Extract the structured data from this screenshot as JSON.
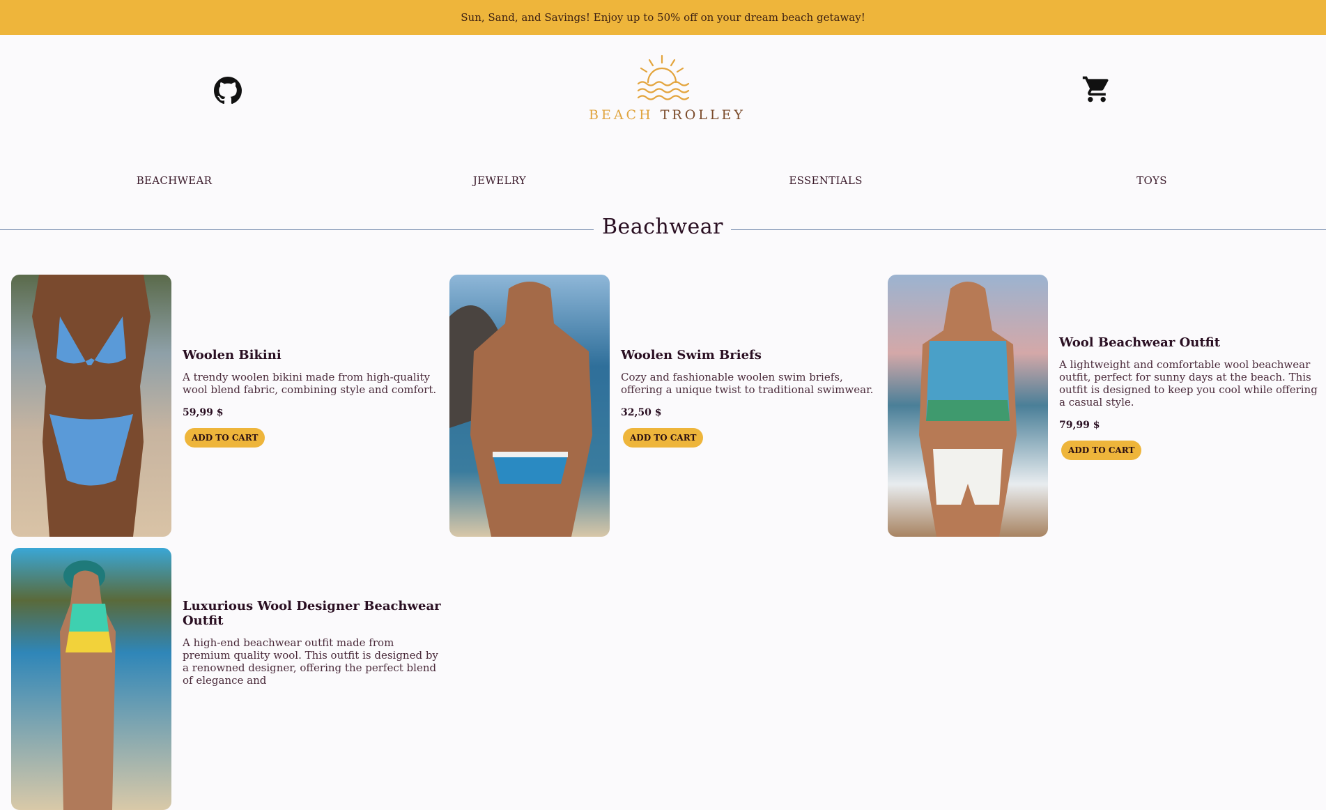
{
  "promo": {
    "text": "Sun, Sand, and Savings! Enjoy up to 50% off on your dream beach getaway!"
  },
  "header": {
    "logo_text_part1": "BEACH",
    "logo_text_part2": "TROLLEY",
    "github_icon": "github-icon",
    "cart_icon": "cart-icon"
  },
  "nav": {
    "items": [
      "BEACHWEAR",
      "JEWELRY",
      "ESSENTIALS",
      "TOYS"
    ]
  },
  "section": {
    "title": "Beachwear"
  },
  "colors": {
    "accent": "#eeb53b",
    "background": "#fbfafc",
    "text": "#2a0f22",
    "rule": "#7d93b3"
  },
  "products": [
    {
      "name": "Woolen Bikini",
      "description": "A trendy woolen bikini made from high-quality wool blend fabric, combining style and comfort.",
      "price": "59,99 $",
      "button": "ADD TO CART"
    },
    {
      "name": "Woolen Swim Briefs",
      "description": "Cozy and fashionable woolen swim briefs, offering a unique twist to traditional swimwear.",
      "price": "32,50 $",
      "button": "ADD TO CART"
    },
    {
      "name": "Wool Beachwear Outfit",
      "description": "A lightweight and comfortable wool beachwear outfit, perfect for sunny days at the beach. This outfit is designed to keep you cool while offering a casual style.",
      "price": "79,99 $",
      "button": "ADD TO CART"
    },
    {
      "name": "Luxurious Wool Designer Beachwear Outfit",
      "description": "A high-end beachwear outfit made from premium quality wool. This outfit is designed by a renowned designer, offering the perfect blend of elegance and",
      "price": "",
      "button": ""
    }
  ]
}
